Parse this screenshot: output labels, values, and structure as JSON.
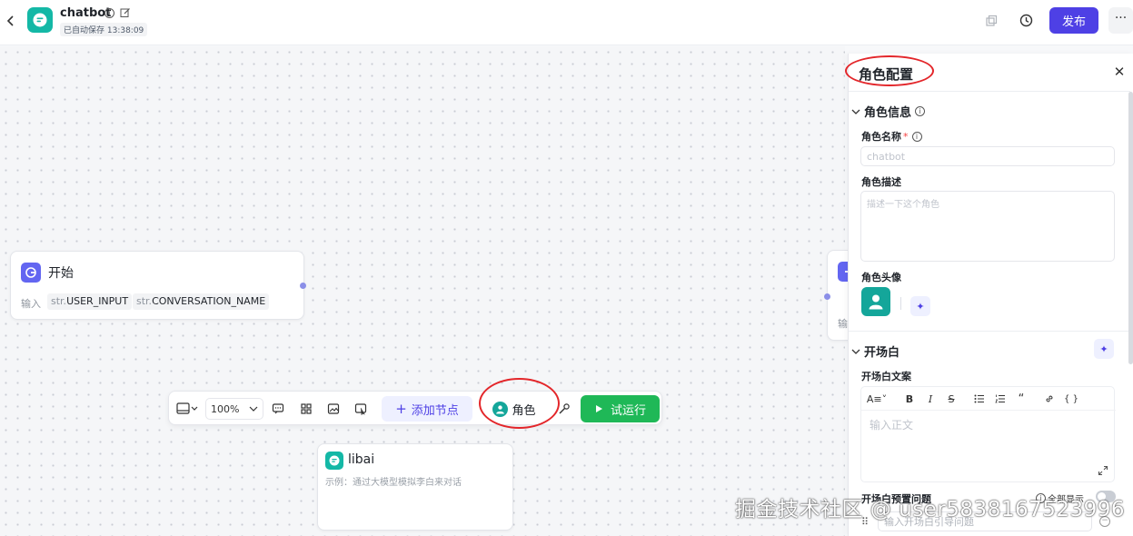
{
  "header": {
    "app_name": "chatbot",
    "save_status": "已自动保存 13:38:09",
    "publish_label": "发布",
    "more_label": "···"
  },
  "canvas": {
    "start_node": {
      "title": "开始",
      "input_label": "输入",
      "vars": [
        {
          "type": "str.",
          "name": "USER_INPUT"
        },
        {
          "type": "str.",
          "name": "CONVERSATION_NAME"
        }
      ]
    },
    "end_node": {
      "input_label": "输"
    },
    "libai_node": {
      "title": "libai",
      "description": "示例：通过大模型模拟李白来对话"
    }
  },
  "toolbar": {
    "zoom": "100%",
    "add_node_label": "添加节点",
    "role_label": "角色",
    "run_label": "试运行"
  },
  "panel": {
    "title": "角色配置",
    "role_info": {
      "section_label": "角色信息",
      "name_label": "角色名称",
      "name_required": "*",
      "name_placeholder": "chatbot",
      "desc_label": "角色描述",
      "desc_placeholder": "描述一下这个角色",
      "avatar_label": "角色头像"
    },
    "opening": {
      "section_label": "开场白",
      "text_label": "开场白文案",
      "editor_placeholder": "输入正文",
      "preset_label": "开场白预置问题",
      "show_all_label": "全部显示",
      "question_placeholder": "输入开场白引导问题"
    }
  },
  "watermark": "掘金技术社区 @ user5838167523996",
  "colors": {
    "accent": "#4e40e5",
    "run": "#1fb857",
    "teal": "#14a69a",
    "annotation": "#e3262a"
  }
}
